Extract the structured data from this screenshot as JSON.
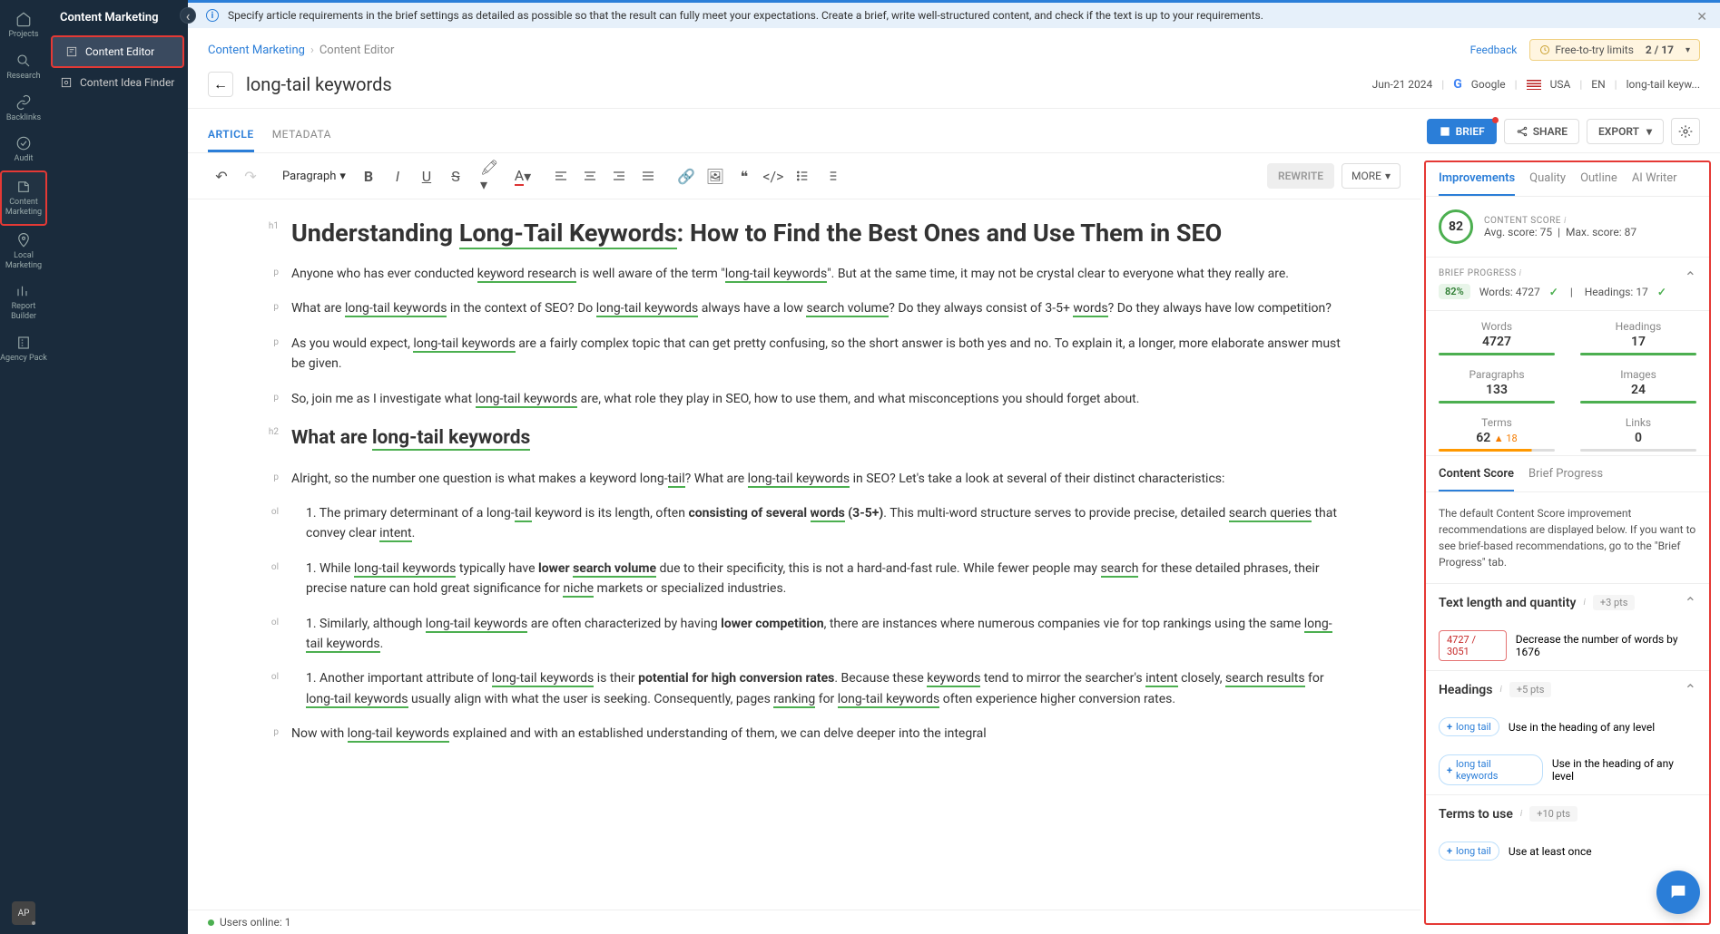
{
  "leftRail": [
    {
      "icon": "home",
      "label": "Projects"
    },
    {
      "icon": "search",
      "label": "Research"
    },
    {
      "icon": "link",
      "label": "Backlinks"
    },
    {
      "icon": "check",
      "label": "Audit"
    },
    {
      "icon": "edit",
      "label": "Content Marketing",
      "active": true
    },
    {
      "icon": "pin",
      "label": "Local Marketing"
    },
    {
      "icon": "chart",
      "label": "Report Builder"
    },
    {
      "icon": "building",
      "label": "Agency Pack"
    }
  ],
  "avatar": "AP",
  "sidePanel": {
    "title": "Content Marketing",
    "items": [
      {
        "label": "Content Editor",
        "active": true
      },
      {
        "label": "Content Idea Finder",
        "active": false
      }
    ]
  },
  "infoBar": "Specify article requirements in the brief settings as detailed as possible so that the result can fully meet your expectations. Create a brief, write well-structured content, and check if the text is up to your requirements.",
  "breadcrumbs": [
    "Content Marketing",
    "Content Editor"
  ],
  "feedback": "Feedback",
  "freeTry": {
    "text": "Free-to-try limits",
    "val": "2 / 17"
  },
  "title": "long-tail keywords",
  "titleMeta": {
    "date": "Jun-21 2024",
    "engine": "Google",
    "country": "USA",
    "lang": "EN",
    "kw": "long-tail keyw..."
  },
  "tabs": [
    "ARTICLE",
    "METADATA"
  ],
  "actions": {
    "brief": "BRIEF",
    "share": "SHARE",
    "export": "EXPORT"
  },
  "toolbar": {
    "para": "Paragraph",
    "rewrite": "REWRITE",
    "more": "MORE"
  },
  "article": {
    "h1": "Understanding Long-Tail Keywords: How to Find the Best Ones and Use Them in SEO",
    "p1": "Anyone who has ever conducted keyword research is well aware of the term \"long-tail keywords\". But at the same time, it may not be crystal clear to everyone what they really are.",
    "p2": "What are long-tail keywords in the context of SEO? Do long-tail keywords always have a low search volume? Do they always consist of 3-5+ words? Do they always have low competition?",
    "p3": "As you would expect, long-tail keywords are a fairly complex topic that can get pretty confusing, so the short answer is both yes and no. To explain it, a longer, more elaborate answer must be given.",
    "p4": "So, join me as I investigate what long-tail keywords are, what role they play in SEO, how to use them, and what misconceptions you should forget about.",
    "h2": "What are long-tail keywords",
    "p5": "Alright, so the number one question is what makes a keyword long-tail? What are long-tail keywords in SEO? Let's take a look at several of their distinct characteristics:",
    "ol1": "The primary determinant of a long-tail keyword is its length, often consisting of several words (3-5+). This multi-word structure serves to provide precise, detailed search queries that convey clear intent.",
    "ol2": "While long-tail keywords typically have lower search volume due to their specificity, this is not a hard-and-fast rule. While fewer people may search for these detailed phrases, their precise nature can hold great significance for niche markets or specialized industries.",
    "ol3": "Similarly, although long-tail keywords are often characterized by having lower competition, there are instances where numerous companies vie for top rankings using the same long-tail keywords.",
    "ol4": "Another important attribute of long-tail keywords is their potential for high conversion rates. Because these keywords tend to mirror the searcher's intent closely, search results for long-tail keywords usually align with what the user is seeking. Consequently, pages ranking for long-tail keywords often experience higher conversion rates.",
    "p6": "Now with long-tail keywords explained and with an established understanding of them, we can delve deeper into the integral"
  },
  "usersOnline": "Users online: 1",
  "rightPanel": {
    "tabs": [
      "Improvements",
      "Quality",
      "Outline",
      "AI Writer"
    ],
    "score": {
      "label": "CONTENT SCORE",
      "val": "82",
      "avg": "Avg. score: 75",
      "max": "Max. score: 87"
    },
    "brief": {
      "label": "BRIEF PROGRESS",
      "pct": "82%",
      "words": "Words: 4727",
      "headings": "Headings: 17"
    },
    "metrics": [
      {
        "name": "Words",
        "val": "4727",
        "bar": "green"
      },
      {
        "name": "Headings",
        "val": "17",
        "bar": "green"
      },
      {
        "name": "Paragraphs",
        "val": "133",
        "bar": "green"
      },
      {
        "name": "Images",
        "val": "24",
        "bar": "green"
      },
      {
        "name": "Terms",
        "val": "62",
        "warn": "▲ 18",
        "bar": "orange"
      },
      {
        "name": "Links",
        "val": "0",
        "bar": "grey"
      }
    ],
    "subTabs": [
      "Content Score",
      "Brief Progress"
    ],
    "recText": "The default Content Score improvement recommendations are displayed below. If you want to see brief-based recommendations, go to the \"Brief Progress\" tab.",
    "textLength": {
      "title": "Text length and quantity",
      "pts": "+3 pts",
      "pill": "4727 / 3051",
      "msg": "Decrease the number of words by 1676"
    },
    "headings": {
      "title": "Headings",
      "pts": "+5 pts",
      "items": [
        {
          "pill": "long tail",
          "msg": "Use in the heading of any level"
        },
        {
          "pill": "long tail keywords",
          "msg": "Use in the heading of any level"
        }
      ]
    },
    "terms": {
      "title": "Terms to use",
      "pts": "+10 pts",
      "items": [
        {
          "pill": "long tail",
          "msg": "Use at least once"
        }
      ]
    }
  }
}
